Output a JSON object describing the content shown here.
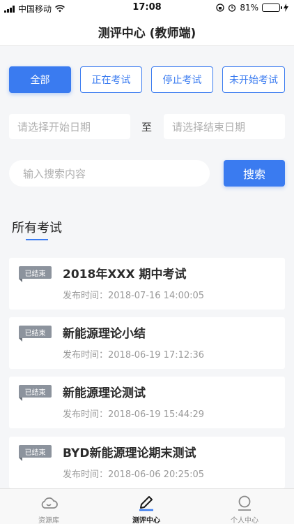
{
  "status_bar": {
    "carrier": "中国移动",
    "time": "17:08",
    "battery": "81%",
    "battery_level": 0.81
  },
  "nav": {
    "title": "测评中心 (教师端)"
  },
  "filters": [
    {
      "label": "全部",
      "active": true
    },
    {
      "label": "正在考试",
      "active": false
    },
    {
      "label": "停止考试",
      "active": false
    },
    {
      "label": "未开始考试",
      "active": false
    }
  ],
  "date_range": {
    "start_placeholder": "请选择开始日期",
    "separator": "至",
    "end_placeholder": "请选择结束日期"
  },
  "search": {
    "placeholder": "输入搜索内容",
    "button_label": "搜索"
  },
  "section": {
    "title": "所有考试"
  },
  "exams": [
    {
      "status": "已结束",
      "title": "2018年XXX 期中考试",
      "time": "发布时间：2018-07-16 14:00:05"
    },
    {
      "status": "已结束",
      "title": "新能源理论小结",
      "time": "发布时间：2018-06-19 17:12:36"
    },
    {
      "status": "已结束",
      "title": "新能源理论测试",
      "time": "发布时间：2018-06-19 15:44:29"
    },
    {
      "status": "已结束",
      "title": "BYD新能源理论期末测试",
      "time": "发布时间：2018-06-06 20:25:05"
    }
  ],
  "tabs": [
    {
      "label": "资源库",
      "icon": "cloud-icon",
      "active": false
    },
    {
      "label": "测评中心",
      "icon": "pencil-icon",
      "active": true
    },
    {
      "label": "个人中心",
      "icon": "person-icon",
      "active": false
    }
  ],
  "colors": {
    "accent": "#3a7bf0",
    "badge": "#8c939d"
  }
}
